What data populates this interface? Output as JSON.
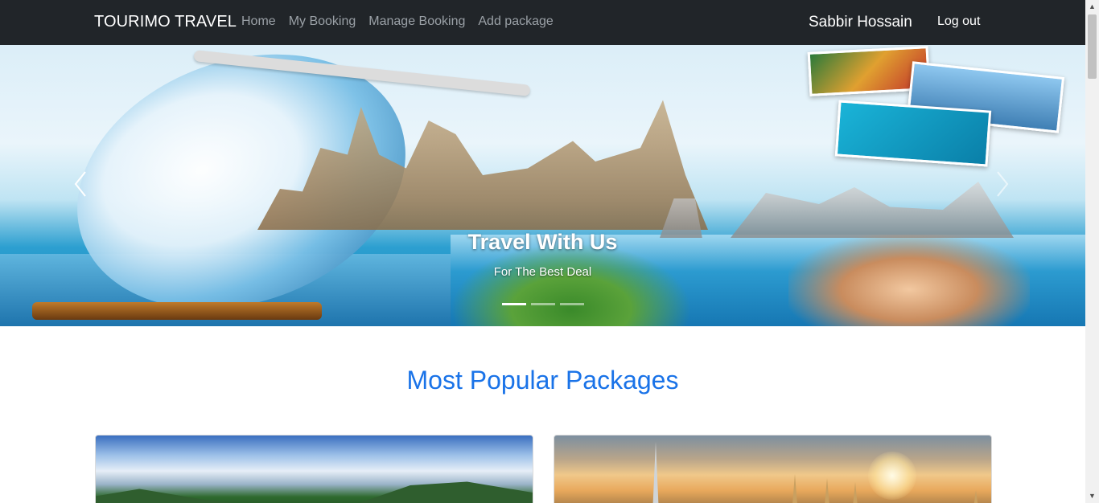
{
  "navbar": {
    "brand": "TOURIMO TRAVEL",
    "links": [
      {
        "label": "Home"
      },
      {
        "label": "My Booking"
      },
      {
        "label": "Manage Booking"
      },
      {
        "label": "Add package"
      }
    ],
    "user_name": "Sabbir Hossain",
    "logout_label": "Log out"
  },
  "carousel": {
    "caption_title": "Travel With Us",
    "caption_subtitle": "For The Best Deal",
    "slide_count": 3,
    "active_slide": 1,
    "prev_icon": "chevron-left-icon",
    "next_icon": "chevron-right-icon"
  },
  "packages": {
    "heading": "Most Popular Packages"
  },
  "colors": {
    "navbar_bg": "#212529",
    "heading_blue": "#1a73e8",
    "nav_link": "#9aa0a6"
  }
}
